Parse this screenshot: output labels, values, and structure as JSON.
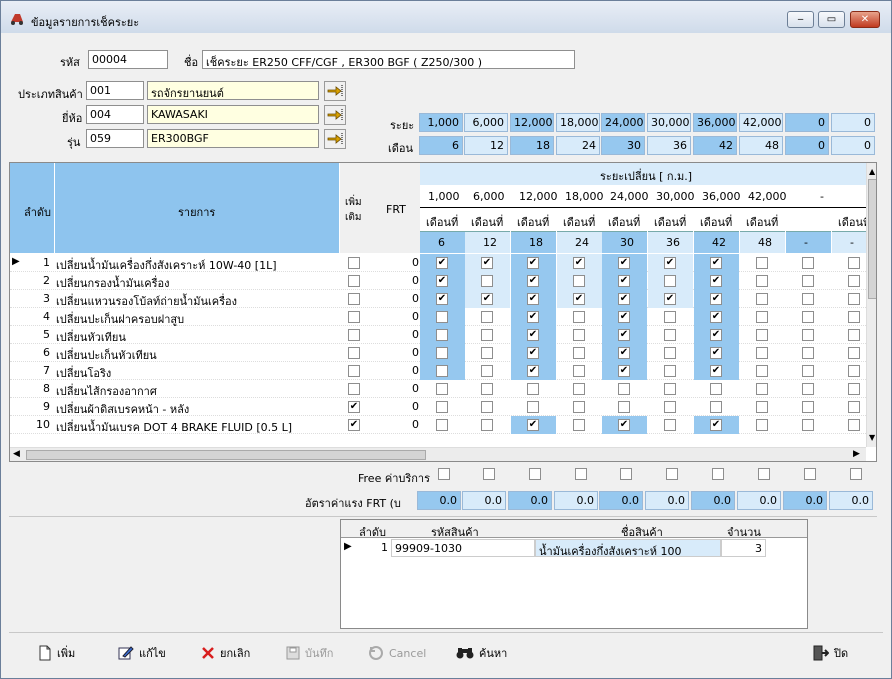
{
  "window": {
    "title": "ข้อมูลรายการเช็คระยะ",
    "min": "‒",
    "max": "▭",
    "close": "✕"
  },
  "form": {
    "code_label": "รหัส",
    "code_value": "00004",
    "name_label": "ชื่อ",
    "name_value": "เช็คระยะ ER250 CFF/CGF , ER300 BGF ( Z250/300 )",
    "type_label": "ประเภทสินค้า",
    "type_code": "001",
    "type_name": "รถจักรยานยนต์",
    "brand_label": "ยี่ห้อ",
    "brand_code": "004",
    "brand_name": "KAWASAKI",
    "model_label": "รุ่น",
    "model_code": "059",
    "model_name": "ER300BGF"
  },
  "distance": {
    "label": "ระยะ",
    "values": [
      "1,000",
      "6,000",
      "12,000",
      "18,000",
      "24,000",
      "30,000",
      "36,000",
      "42,000",
      "0",
      "0"
    ]
  },
  "month": {
    "label": "เดือน",
    "values": [
      "6",
      "12",
      "18",
      "24",
      "30",
      "36",
      "42",
      "48",
      "0",
      "0"
    ]
  },
  "grid": {
    "col_seq": "ลำดับ",
    "col_item": "รายการ",
    "col_add": "เพิ่มเติม",
    "col_frt": "FRT",
    "interval_header": "ระยะเปลี่ยน [ ก.ม.]",
    "km_headers": [
      "1,000",
      "6,000",
      "12,000",
      "18,000",
      "24,000",
      "30,000",
      "36,000",
      "42,000",
      "-"
    ],
    "month_label": "เดือนที่",
    "month_vals": [
      "6",
      "12",
      "18",
      "24",
      "30",
      "36",
      "42",
      "48",
      "-",
      "-"
    ],
    "rows": [
      {
        "seq": "1",
        "item": "เปลี่ยนน้ำมันเครื่องกึ่งสังเคราะห์ 10W-40 [1L]",
        "add": false,
        "frt": "0",
        "c": [
          1,
          1,
          1,
          1,
          1,
          1,
          1,
          0,
          0,
          0
        ]
      },
      {
        "seq": "2",
        "item": "เปลี่ยนกรองน้ำมันเครื่อง",
        "add": false,
        "frt": "0",
        "c": [
          1,
          0,
          1,
          0,
          1,
          0,
          1,
          0,
          0,
          0
        ]
      },
      {
        "seq": "3",
        "item": "เปลี่ยนแหวนรองโบ้ลท์ถ่ายน้ำมันเครื่อง",
        "add": false,
        "frt": "0",
        "c": [
          1,
          1,
          1,
          1,
          1,
          1,
          1,
          0,
          0,
          0
        ]
      },
      {
        "seq": "4",
        "item": "เปลี่ยนปะเก็นฝาครอบฝาสูบ",
        "add": false,
        "frt": "0",
        "c": [
          0,
          0,
          1,
          0,
          1,
          0,
          1,
          0,
          0,
          0
        ]
      },
      {
        "seq": "5",
        "item": "เปลี่ยนหัวเทียน",
        "add": false,
        "frt": "0",
        "c": [
          0,
          0,
          1,
          0,
          1,
          0,
          1,
          0,
          0,
          0
        ]
      },
      {
        "seq": "6",
        "item": "เปลี่ยนปะเก็นหัวเทียน",
        "add": false,
        "frt": "0",
        "c": [
          0,
          0,
          1,
          0,
          1,
          0,
          1,
          0,
          0,
          0
        ]
      },
      {
        "seq": "7",
        "item": "เปลี่ยนโอริง",
        "add": false,
        "frt": "0",
        "c": [
          0,
          0,
          1,
          0,
          1,
          0,
          1,
          0,
          0,
          0
        ]
      },
      {
        "seq": "8",
        "item": "เปลี่ยนไส้กรองอากาศ",
        "add": false,
        "frt": "0",
        "c": [
          0,
          0,
          0,
          0,
          0,
          0,
          0,
          0,
          0,
          0
        ]
      },
      {
        "seq": "9",
        "item": "เปลี่ยนผ้าดิสเบรคหน้า - หลัง",
        "add": true,
        "frt": "0",
        "c": [
          0,
          0,
          0,
          0,
          0,
          0,
          0,
          0,
          0,
          0
        ]
      },
      {
        "seq": "10",
        "item": "เปลี่ยนน้ำมันเบรค DOT 4 BRAKE FLUID [0.5 L]",
        "add": true,
        "frt": "0",
        "c": [
          0,
          0,
          1,
          0,
          1,
          0,
          1,
          0,
          0,
          0
        ]
      }
    ]
  },
  "free_service": {
    "label": "Free ค่าบริการ"
  },
  "labor": {
    "label": "อัตราค่าแรง FRT (บ",
    "values": [
      "0.0",
      "0.0",
      "0.0",
      "0.0",
      "0.0",
      "0.0",
      "0.0",
      "0.0",
      "0.0",
      "0.0"
    ]
  },
  "parts": {
    "col_seq": "ลำดับ",
    "col_code": "รหัสสินค้า",
    "col_name": "ชื่อสินค้า",
    "col_qty": "จำนวน",
    "rows": [
      {
        "seq": "1",
        "code": "99909-1030",
        "name": "น้ำมันเครื่องกึ่งสังเคราะห์ 100",
        "qty": "3"
      }
    ]
  },
  "toolbar": {
    "add": "เพิ่ม",
    "edit": "แก้ไข",
    "cancel_th": "ยกเลิก",
    "save": "บันทึก",
    "cancel_en": "Cancel",
    "search": "ค้นหา",
    "close": "ปิด"
  },
  "colors": {
    "highlight": "#96c8ef",
    "light": "#d8ebfa",
    "header_blue": "#8ec4ee",
    "yellow": "#ffffe1"
  }
}
